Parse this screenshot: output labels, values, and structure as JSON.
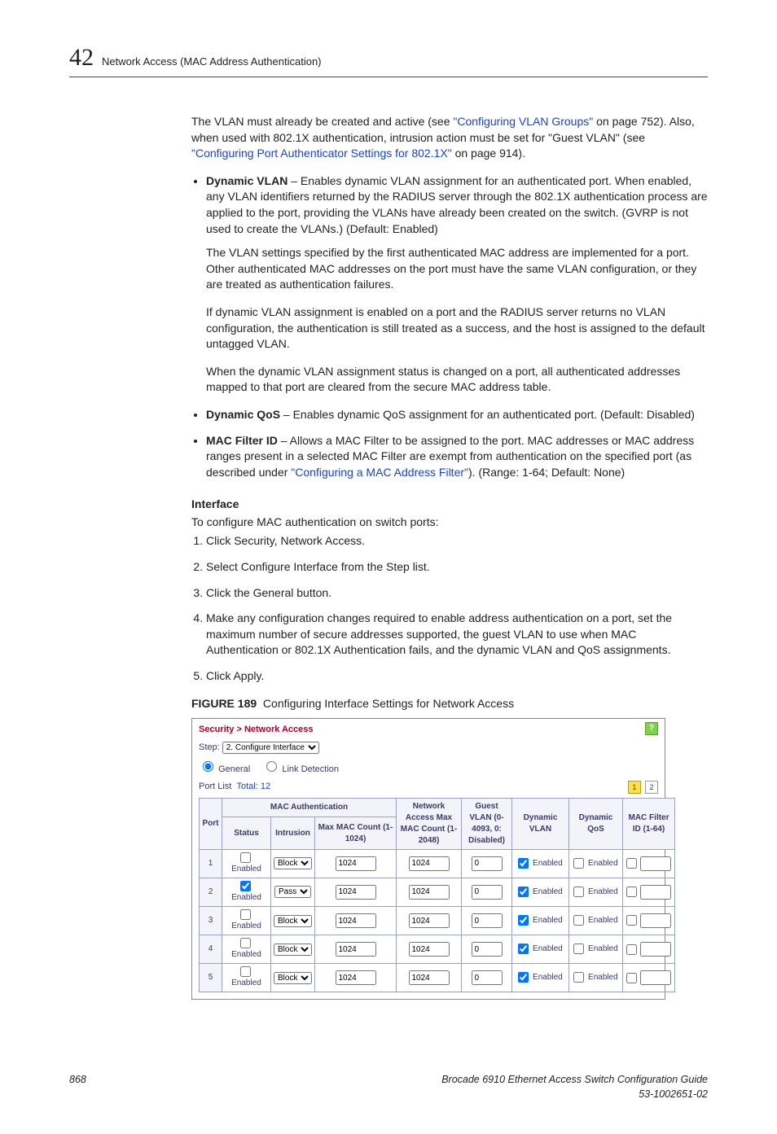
{
  "page": {
    "chapter_num": "42",
    "chapter_title": "Network Access (MAC Address Authentication)",
    "footer_page": "868",
    "footer_title": "Brocade 6910 Ethernet Access Switch Configuration Guide",
    "footer_doc": "53-1002651-02"
  },
  "body": {
    "p1a": "The VLAN must already be created and active (see ",
    "p1_link1": "\"Configuring VLAN Groups\"",
    "p1b": " on page 752). Also, when used with 802.1X authentication, intrusion action must be set for \"Guest VLAN\" (see ",
    "p1_link2": "\"Configuring Port Authenticator Settings for 802.1X\"",
    "p1c": " on page 914).",
    "b1_title": "Dynamic VLAN",
    "b1_text": " – Enables dynamic VLAN assignment for an authenticated port. When enabled, any VLAN identifiers returned by the RADIUS server through the 802.1X authentication process are applied to the port, providing the VLANs have already been created on the switch. (GVRP is not used to create the VLANs.) (Default: Enabled)",
    "b1_p2": "The VLAN settings specified by the first authenticated MAC address are implemented for a port. Other authenticated MAC addresses on the port must have the same VLAN configuration, or they are treated as authentication failures.",
    "b1_p3": "If dynamic VLAN assignment is enabled on a port and the RADIUS server returns no VLAN configuration, the authentication is still treated as a success, and the host is assigned to the default untagged VLAN.",
    "b1_p4": "When the dynamic VLAN assignment status is changed on a port, all authenticated addresses mapped to that port are cleared from the secure MAC address table.",
    "b2_title": "Dynamic QoS",
    "b2_text": " – Enables dynamic QoS assignment for an authenticated port. (Default: Disabled)",
    "b3_title": "MAC Filter ID",
    "b3_texta": " – Allows a MAC Filter to be assigned to the port. MAC addresses or MAC address ranges present in a selected MAC Filter are exempt from authentication on the specified port (as described under ",
    "b3_link": "\"Configuring a MAC Address Filter\"",
    "b3_textb": "). (Range: 1-64; Default: None)",
    "interface_hd": "Interface",
    "interface_intro": "To configure MAC authentication on switch ports:",
    "steps": [
      "Click Security, Network Access.",
      "Select Configure Interface from the Step list.",
      "Click the General button.",
      "Make any configuration changes required to enable address authentication on a port, set the maximum number of secure addresses supported, the guest VLAN to use when MAC Authentication or 802.1X Authentication fails, and the dynamic VLAN and QoS assignments.",
      "Click Apply."
    ],
    "figure_label": "FIGURE 189",
    "figure_title": "Configuring Interface Settings for Network Access"
  },
  "shot": {
    "breadcrumb": "Security > Network Access",
    "step_label": "Step:",
    "step_value": "2. Configure Interface",
    "radio_general": "General",
    "radio_link": "Link Detection",
    "portlist_label": "Port List",
    "portlist_total": "Total: 12",
    "pager": [
      "1",
      "2"
    ],
    "headers": {
      "port": "Port",
      "mac_auth": "MAC Authentication",
      "status": "Status",
      "intrusion": "Intrusion",
      "maxmac": "Max MAC Count (1-1024)",
      "netacc": "Network Access Max MAC Count (1-2048)",
      "guest": "Guest VLAN (0-4093, 0: Disabled)",
      "dvlan": "Dynamic VLAN",
      "dqos": "Dynamic QoS",
      "filter": "MAC Filter ID (1-64)"
    },
    "rows": [
      {
        "port": "1",
        "status_chk": false,
        "intrusion": "Block",
        "maxmac": "1024",
        "netmac": "1024",
        "guest": "0",
        "dvlan_chk": true,
        "dqos_chk": false,
        "filter_chk": false,
        "filter_val": ""
      },
      {
        "port": "2",
        "status_chk": true,
        "intrusion": "Pass",
        "maxmac": "1024",
        "netmac": "1024",
        "guest": "0",
        "dvlan_chk": true,
        "dqos_chk": false,
        "filter_chk": false,
        "filter_val": ""
      },
      {
        "port": "3",
        "status_chk": false,
        "intrusion": "Block",
        "maxmac": "1024",
        "netmac": "1024",
        "guest": "0",
        "dvlan_chk": true,
        "dqos_chk": false,
        "filter_chk": false,
        "filter_val": ""
      },
      {
        "port": "4",
        "status_chk": false,
        "intrusion": "Block",
        "maxmac": "1024",
        "netmac": "1024",
        "guest": "0",
        "dvlan_chk": true,
        "dqos_chk": false,
        "filter_chk": false,
        "filter_val": ""
      },
      {
        "port": "5",
        "status_chk": false,
        "intrusion": "Block",
        "maxmac": "1024",
        "netmac": "1024",
        "guest": "0",
        "dvlan_chk": true,
        "dqos_chk": false,
        "filter_chk": false,
        "filter_val": ""
      }
    ],
    "enabled_label": "Enabled"
  }
}
